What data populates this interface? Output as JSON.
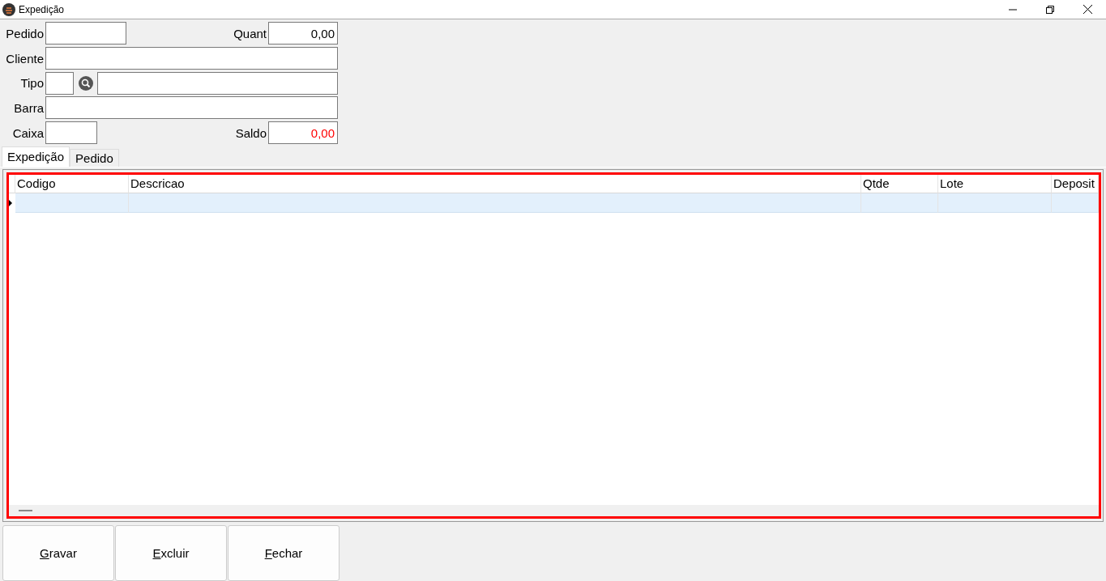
{
  "window": {
    "title": "Expedição"
  },
  "form": {
    "pedido": {
      "label": "Pedido"
    },
    "quant": {
      "label": "Quant",
      "value": "0,00"
    },
    "cliente": {
      "label": "Cliente"
    },
    "tipo": {
      "label": "Tipo"
    },
    "barra": {
      "label": "Barra"
    },
    "caixa": {
      "label": "Caixa"
    },
    "saldo": {
      "label": "Saldo",
      "value": "0,00",
      "negative_style": true
    }
  },
  "tabs": [
    {
      "label": "Expedição",
      "selected": true
    },
    {
      "label": "Pedido",
      "selected": false
    }
  ],
  "table": {
    "outlined": true,
    "columns": [
      "Codigo",
      "Descricao",
      "Qtde",
      "Lote",
      "Deposit"
    ],
    "rows": [
      {
        "selected": true
      }
    ]
  },
  "buttons": [
    {
      "label": "Gravar",
      "underline_first": true
    },
    {
      "label": "Excluir",
      "underline_first": true
    },
    {
      "label": "Fechar",
      "underline_first": true
    }
  ]
}
